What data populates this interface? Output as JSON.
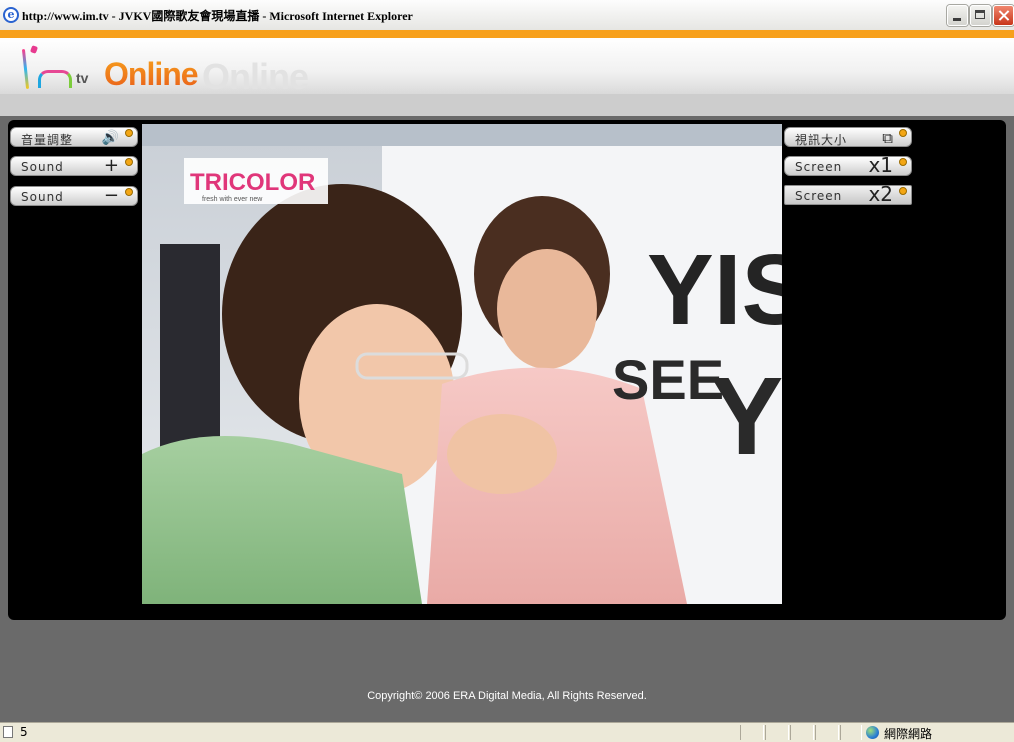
{
  "window": {
    "title": "http://www.im.tv - JVKV國際歌友會現場直播 - Microsoft Internet Explorer"
  },
  "site": {
    "logo_text": "Online",
    "logo_tv": "tv",
    "logo_ghost": "Online"
  },
  "controls": {
    "left": [
      {
        "label": "音量調整",
        "glyph": "🔊"
      },
      {
        "label": "Sound",
        "glyph": "+"
      },
      {
        "label": "Sound",
        "glyph": "−"
      }
    ],
    "right": [
      {
        "label": "視訊大小",
        "glyph": "⧉"
      },
      {
        "label": "Screen",
        "glyph": "x1"
      },
      {
        "label": "Screen",
        "glyph": "x2"
      }
    ]
  },
  "video": {
    "overlay_logo": "TRICOLOR",
    "overlay_sub": "fresh with ever new",
    "backdrop_text_1": "YISH",
    "backdrop_text_2": "SEE",
    "backdrop_text_3": "Y"
  },
  "footer": {
    "copyright": "Copyright© 2006 ERA Digital Media, All Rights Reserved."
  },
  "statusbar": {
    "text": "5",
    "zone": "網際網路"
  }
}
